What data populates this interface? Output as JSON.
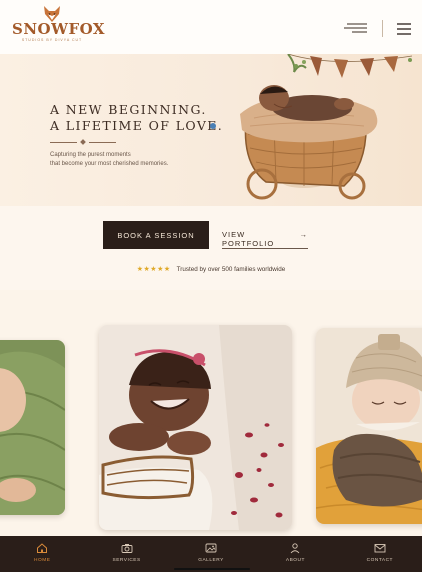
{
  "header": {
    "brand": "SNOWFOX",
    "tagline": "STUDIOS BY DIVYA CUT",
    "logo_icon": "fox-icon",
    "menu_icon": "hamburger-icon",
    "secondary_menu_icon": "menu-lines-icon"
  },
  "hero": {
    "title_line1": "A NEW BEGINNING.",
    "title_line2": "A LIFETIME OF LOVE.",
    "subtitle_line1": "Capturing the purest moments",
    "subtitle_line2": "that become your most cherished memories."
  },
  "cta": {
    "book_label": "BOOK A SESSION",
    "portfolio_label": "VIEW PORTFOLIO",
    "portfolio_arrow": "→",
    "rating_stars": 5,
    "trust_text": "Trusted by over 500 families worldwide"
  },
  "nav": {
    "active": "home",
    "items": [
      {
        "id": "home",
        "label": "HOME",
        "icon": "home-icon"
      },
      {
        "id": "services",
        "label": "SERVICES",
        "icon": "camera-icon"
      },
      {
        "id": "gallery",
        "label": "GALLERY",
        "icon": "gallery-icon"
      },
      {
        "id": "about",
        "label": "ABOUT",
        "icon": "user-icon"
      },
      {
        "id": "contact",
        "label": "CONTACT",
        "icon": "mail-icon"
      }
    ]
  },
  "colors": {
    "accent": "#d88a3a",
    "brand": "#a35a2a",
    "dark": "#2a1e19",
    "page_bg": "#fdf6ee",
    "rating": "#e0a928"
  }
}
